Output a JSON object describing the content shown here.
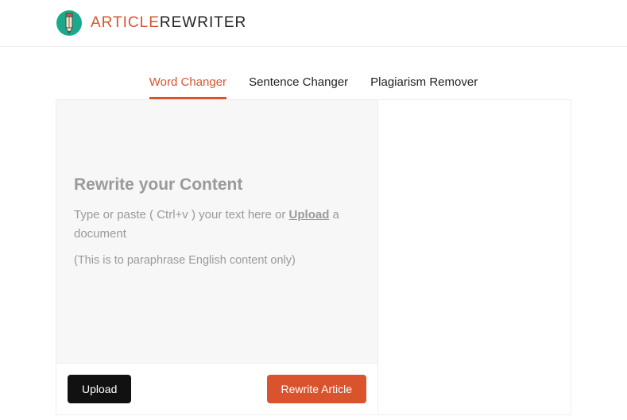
{
  "brand": {
    "first": "ARTICLE",
    "second": "REWRITER"
  },
  "tabs": {
    "word_changer": "Word Changer",
    "sentence_changer": "Sentence Changer",
    "plagiarism_remover": "Plagiarism Remover"
  },
  "editor": {
    "title": "Rewrite your Content",
    "hint_pre": "Type or paste ( Ctrl+v ) your text here or ",
    "hint_upload": "Upload",
    "hint_post": " a document",
    "note": "(This is to paraphrase English content only)"
  },
  "buttons": {
    "upload": "Upload",
    "rewrite": "Rewrite Article"
  }
}
